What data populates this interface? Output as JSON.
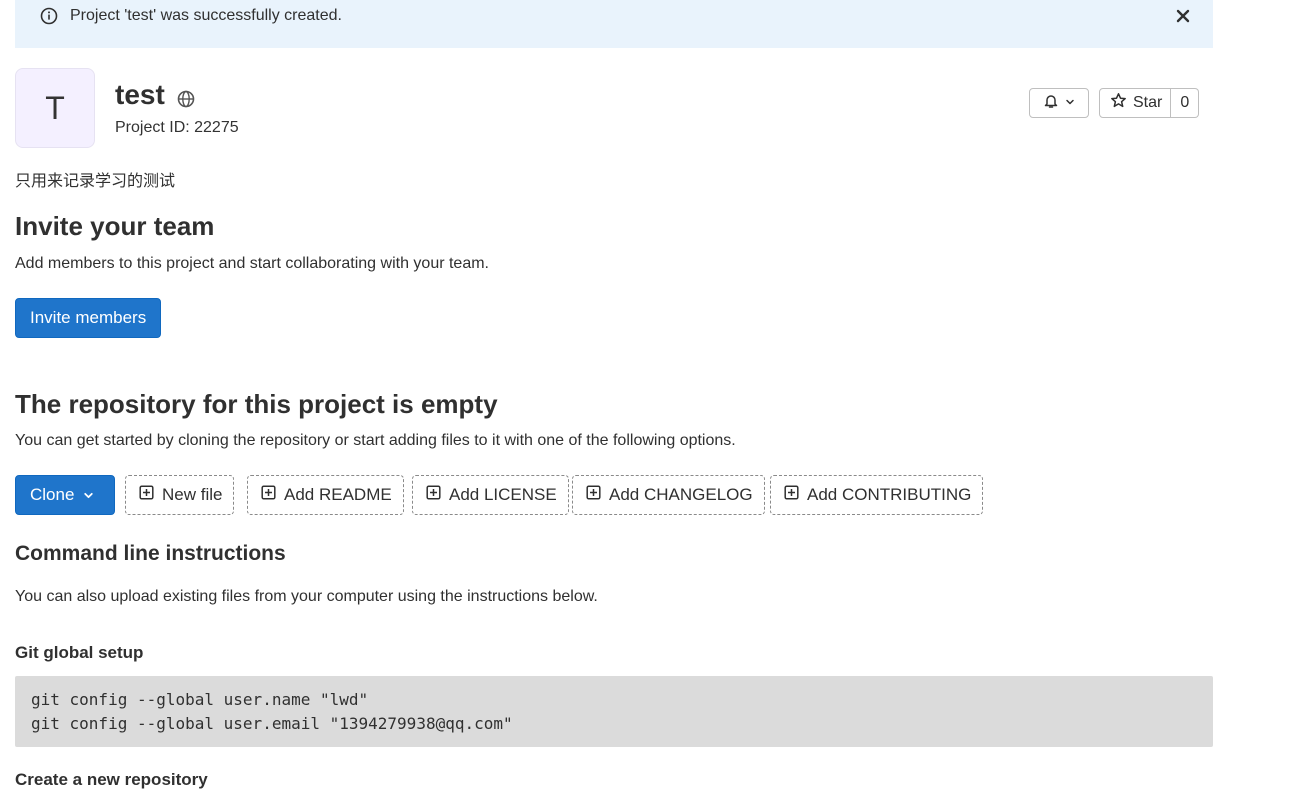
{
  "flash": {
    "message": "Project 'test' was successfully created.",
    "icons": {
      "info": "info-circle-icon",
      "close": "close-icon"
    }
  },
  "project": {
    "avatar_letter": "T",
    "title": "test",
    "visibility_icon": "globe-icon",
    "id_label": "Project ID: 22275",
    "description": "只用来记录学习的测试"
  },
  "actions": {
    "notification_icon": "bell-icon",
    "star_label": "Star",
    "star_count": "0"
  },
  "invite": {
    "heading": "Invite your team",
    "text": "Add members to this project and start collaborating with your team.",
    "button_label": "Invite members"
  },
  "empty_repo": {
    "heading": "The repository for this project is empty",
    "text": "You can get started by cloning the repository or start adding files to it with one of the following options.",
    "clone_label": "Clone",
    "file_buttons": [
      "New file",
      "Add README",
      "Add LICENSE",
      "Add CHANGELOG",
      "Add CONTRIBUTING"
    ]
  },
  "cli": {
    "heading": "Command line instructions",
    "text": "You can also upload existing files from your computer using the instructions below.",
    "global_setup_heading": "Git global setup",
    "global_setup_lines": [
      "git config --global user.name \"lwd\"",
      "git config --global user.email \"1394279938@qq.com\""
    ],
    "new_repo_heading": "Create a new repository"
  },
  "colors": {
    "primary": "#1f75cb",
    "flash_bg": "#e9f3fc",
    "code_bg": "#dbdbdb",
    "avatar_bg": "#f4f0ff"
  }
}
